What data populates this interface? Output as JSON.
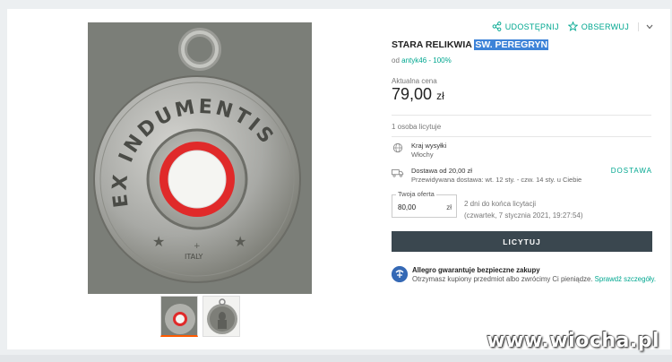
{
  "header": {
    "share_label": "UDOSTĘPNIJ",
    "follow_label": "OBSERWUJ",
    "more_icon": "chevron-down-icon"
  },
  "product": {
    "title_plain": "STARA RELIKWIA",
    "title_highlight": "SW. PEREGRYN",
    "seller_prefix": "od",
    "seller_name": "antyk46 - 100%",
    "medal_text": "EX INDUMENTIS",
    "medal_italy": "ITALY"
  },
  "price": {
    "label": "Aktualna cena",
    "amount": "79,00",
    "currency": "zł"
  },
  "bidders": "1 osoba licytuje",
  "shipping": {
    "country_label": "Kraj wysyłki",
    "country": "Włochy",
    "delivery_label": "Dostawa od 20,00 zł",
    "delivery_estimate": "Przewidywana dostawa: wt. 12 sty. - czw. 14 sty. u Ciebie",
    "delivery_link": "DOSTAWA"
  },
  "bid": {
    "label": "Twoja oferta",
    "value": "80,00",
    "currency": "zł",
    "time_left": "2 dni do końca licytacji",
    "end_date": "(czwartek, 7 stycznia 2021, 19:27:54)",
    "button_label": "LICYTUJ"
  },
  "guarantee": {
    "title": "Allegro gwarantuje bezpieczne zakupy",
    "text": "Otrzymasz kupiony przedmiot albo zwrócimy Ci pieniądze.",
    "link": "Sprawdź szczegóły."
  },
  "watermark": "www.wiocha.pl",
  "colors": {
    "accent": "#00a790",
    "button": "#3a474f",
    "highlight": "#3d83d8",
    "medal_red": "#e02a2a"
  }
}
